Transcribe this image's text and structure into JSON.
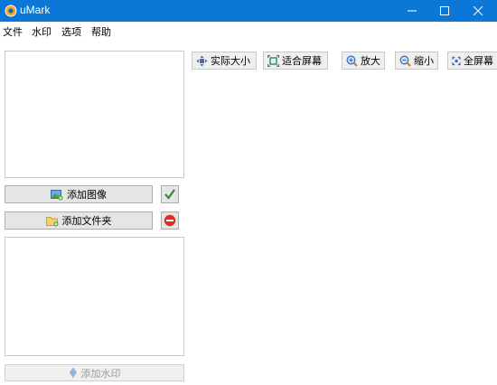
{
  "window": {
    "title": "uMark"
  },
  "menu": {
    "items": [
      "文件",
      "水印",
      "选项",
      "帮助"
    ]
  },
  "left": {
    "add_image_label": "添加图像",
    "add_folder_label": "添加文件夹",
    "add_watermark_label": "添加水印"
  },
  "toolbar": {
    "actual_size_label": "实际大小",
    "fit_screen_label": "适合屏幕",
    "zoom_in_label": "放大",
    "zoom_out_label": "缩小",
    "fullscreen_label": "全屏幕"
  },
  "colors": {
    "titlebar": "#0b78d7",
    "confirm": "#2e8b2e",
    "remove": "#d9302a"
  }
}
